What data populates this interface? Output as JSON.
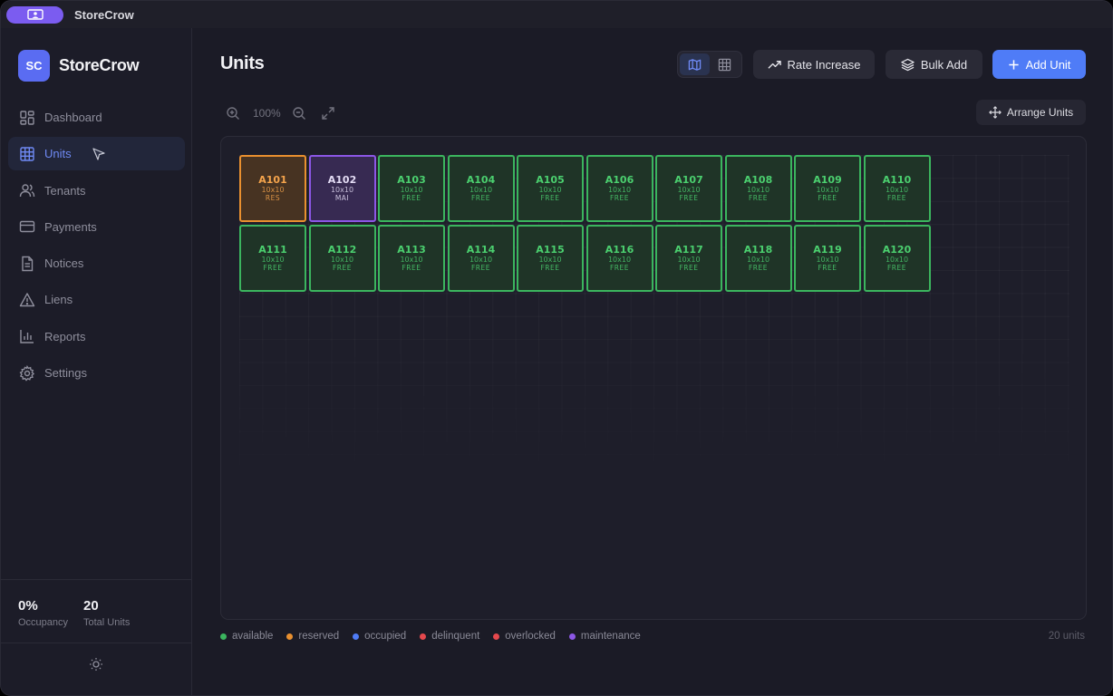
{
  "app": {
    "title": "StoreCrow"
  },
  "sidebar": {
    "logo_initials": "SC",
    "brand": "StoreCrow",
    "items": [
      {
        "label": "Dashboard",
        "icon": "dashboard-icon",
        "active": false
      },
      {
        "label": "Units",
        "icon": "grid-icon",
        "active": true
      },
      {
        "label": "Tenants",
        "icon": "users-icon",
        "active": false
      },
      {
        "label": "Payments",
        "icon": "credit-card-icon",
        "active": false
      },
      {
        "label": "Notices",
        "icon": "document-icon",
        "active": false
      },
      {
        "label": "Liens",
        "icon": "warning-icon",
        "active": false
      },
      {
        "label": "Reports",
        "icon": "bar-chart-icon",
        "active": false
      },
      {
        "label": "Settings",
        "icon": "gear-icon",
        "active": false
      }
    ],
    "stats": {
      "occupancy_value": "0%",
      "occupancy_label": "Occupancy",
      "total_value": "20",
      "total_label": "Total Units"
    }
  },
  "header": {
    "title": "Units",
    "rate_increase_label": "Rate Increase",
    "bulk_add_label": "Bulk Add",
    "add_unit_label": "Add Unit"
  },
  "toolbar": {
    "zoom_level": "100%",
    "arrange_label": "Arrange Units"
  },
  "colors": {
    "available": "#3bb55e",
    "reserved": "#e9902f",
    "occupied": "#4f7cf7",
    "delinquent": "#e5484d",
    "overlocked": "#e5484d",
    "maintenance": "#8c57e6",
    "accent": "#4f7cf7"
  },
  "units": [
    {
      "id": "A101",
      "size": "10x10",
      "status": "RES",
      "state": "reserved"
    },
    {
      "id": "A102",
      "size": "10x10",
      "status": "MAI",
      "state": "maintenance"
    },
    {
      "id": "A103",
      "size": "10x10",
      "status": "FREE",
      "state": "available"
    },
    {
      "id": "A104",
      "size": "10x10",
      "status": "FREE",
      "state": "available"
    },
    {
      "id": "A105",
      "size": "10x10",
      "status": "FREE",
      "state": "available"
    },
    {
      "id": "A106",
      "size": "10x10",
      "status": "FREE",
      "state": "available"
    },
    {
      "id": "A107",
      "size": "10x10",
      "status": "FREE",
      "state": "available"
    },
    {
      "id": "A108",
      "size": "10x10",
      "status": "FREE",
      "state": "available"
    },
    {
      "id": "A109",
      "size": "10x10",
      "status": "FREE",
      "state": "available"
    },
    {
      "id": "A110",
      "size": "10x10",
      "status": "FREE",
      "state": "available"
    },
    {
      "id": "A111",
      "size": "10x10",
      "status": "FREE",
      "state": "available"
    },
    {
      "id": "A112",
      "size": "10x10",
      "status": "FREE",
      "state": "available"
    },
    {
      "id": "A113",
      "size": "10x10",
      "status": "FREE",
      "state": "available"
    },
    {
      "id": "A114",
      "size": "10x10",
      "status": "FREE",
      "state": "available"
    },
    {
      "id": "A115",
      "size": "10x10",
      "status": "FREE",
      "state": "available"
    },
    {
      "id": "A116",
      "size": "10x10",
      "status": "FREE",
      "state": "available"
    },
    {
      "id": "A117",
      "size": "10x10",
      "status": "FREE",
      "state": "available"
    },
    {
      "id": "A118",
      "size": "10x10",
      "status": "FREE",
      "state": "available"
    },
    {
      "id": "A119",
      "size": "10x10",
      "status": "FREE",
      "state": "available"
    },
    {
      "id": "A120",
      "size": "10x10",
      "status": "FREE",
      "state": "available"
    }
  ],
  "legend": [
    {
      "label": "available",
      "color": "#3bb55e"
    },
    {
      "label": "reserved",
      "color": "#e9902f"
    },
    {
      "label": "occupied",
      "color": "#4f7cf7"
    },
    {
      "label": "delinquent",
      "color": "#e5484d"
    },
    {
      "label": "overlocked",
      "color": "#e5484d"
    },
    {
      "label": "maintenance",
      "color": "#8c57e6"
    }
  ],
  "footer": {
    "unit_count": "20 units"
  }
}
